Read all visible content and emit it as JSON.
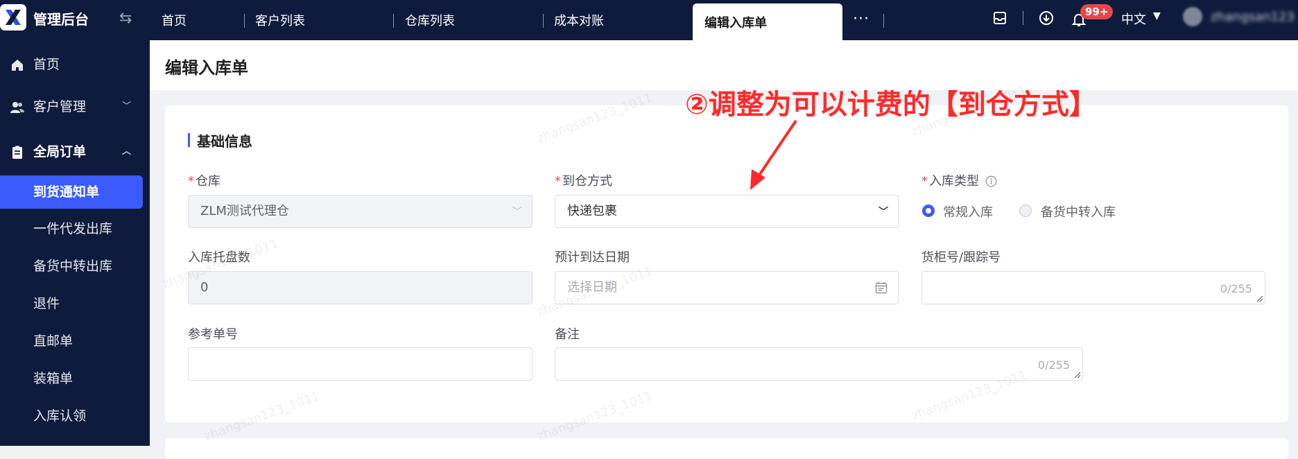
{
  "app": {
    "name": "管理后台"
  },
  "tabs": [
    {
      "label": "首页"
    },
    {
      "label": "客户列表"
    },
    {
      "label": "仓库列表"
    },
    {
      "label": "成本对账"
    }
  ],
  "active_tab": {
    "label": "编辑入库单"
  },
  "header": {
    "more_tabs": "···",
    "notification_badge": "99+",
    "language": "中文"
  },
  "sidebar": {
    "items": [
      {
        "label": "首页",
        "icon": "home-icon"
      },
      {
        "label": "客户管理",
        "icon": "user-group-icon"
      },
      {
        "label": "全局订单",
        "icon": "clipboard-icon"
      }
    ],
    "sub_items": [
      {
        "label": "到货通知单"
      },
      {
        "label": "一件代发出库"
      },
      {
        "label": "备货中转出库"
      },
      {
        "label": "退件"
      },
      {
        "label": "直邮单"
      },
      {
        "label": "装箱单"
      },
      {
        "label": "入库认领"
      }
    ]
  },
  "page": {
    "title": "编辑入库单",
    "section_title": "基础信息"
  },
  "form": {
    "warehouse": {
      "label": "仓库",
      "required": "*",
      "value": "ZLM测试代理仓"
    },
    "arrival_method": {
      "label": "到仓方式",
      "required": "*",
      "value": "快递包裹"
    },
    "inbound_type": {
      "label": "入库类型",
      "required": "*",
      "options": [
        "常规入库",
        "备货中转入库"
      ],
      "selected": "常规入库"
    },
    "pallet_count": {
      "label": "入库托盘数",
      "value": "0"
    },
    "expected_date": {
      "label": "预计到达日期",
      "placeholder": "选择日期"
    },
    "container_no": {
      "label": "货柜号/跟踪号",
      "counter": "0/255"
    },
    "reference_no": {
      "label": "参考单号"
    },
    "remark": {
      "label": "备注",
      "counter": "0/255"
    }
  },
  "annotation": {
    "text": "②调整为可以计费的【到仓方式】"
  },
  "colors": {
    "nav_bg": "#0f1b3d",
    "accent": "#3b5bfd",
    "required": "#e54848",
    "annotation": "#ff2a2a"
  }
}
